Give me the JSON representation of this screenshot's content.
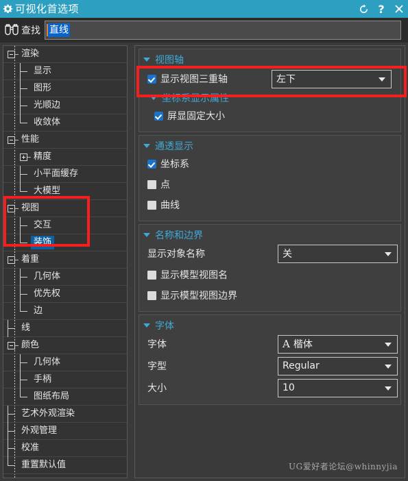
{
  "window": {
    "title": "可视化首选项",
    "icon": "gear-icon",
    "buttons": [
      {
        "name": "reset-button",
        "icon": "reset-icon",
        "label": "↺"
      },
      {
        "name": "help-button",
        "icon": "help-icon",
        "label": "?"
      },
      {
        "name": "close-button",
        "icon": "close-icon",
        "label": "×"
      }
    ]
  },
  "find": {
    "icon": "binoculars-icon",
    "label": "查找",
    "value": "直线",
    "placeholder": ""
  },
  "tree": {
    "items": [
      {
        "label": "渲染",
        "level": 0,
        "expander": "minus",
        "last": false
      },
      {
        "label": "显示",
        "level": 1,
        "expander": "none",
        "last": false
      },
      {
        "label": "图形",
        "level": 1,
        "expander": "none",
        "last": false
      },
      {
        "label": "光顺边",
        "level": 1,
        "expander": "none",
        "last": false
      },
      {
        "label": "收敛体",
        "level": 1,
        "expander": "none",
        "last": true
      },
      {
        "label": "性能",
        "level": 0,
        "expander": "minus",
        "last": false
      },
      {
        "label": "精度",
        "level": 1,
        "expander": "plus",
        "last": false
      },
      {
        "label": "小平面缓存",
        "level": 1,
        "expander": "none",
        "last": false
      },
      {
        "label": "大模型",
        "level": 1,
        "expander": "none",
        "last": true
      },
      {
        "label": "视图",
        "level": 0,
        "expander": "minus",
        "last": false
      },
      {
        "label": "交互",
        "level": 1,
        "expander": "none",
        "last": false
      },
      {
        "label": "装饰",
        "level": 1,
        "expander": "none",
        "last": true,
        "selected": true
      },
      {
        "label": "着重",
        "level": 0,
        "expander": "minus",
        "last": false
      },
      {
        "label": "几何体",
        "level": 1,
        "expander": "none",
        "last": false
      },
      {
        "label": "优先权",
        "level": 1,
        "expander": "none",
        "last": false
      },
      {
        "label": "边",
        "level": 1,
        "expander": "none",
        "last": true
      },
      {
        "label": "线",
        "level": 0,
        "expander": "none",
        "last": false
      },
      {
        "label": "颜色",
        "level": 0,
        "expander": "minus",
        "last": false
      },
      {
        "label": "几何体",
        "level": 1,
        "expander": "none",
        "last": false
      },
      {
        "label": "手柄",
        "level": 1,
        "expander": "none",
        "last": false
      },
      {
        "label": "图纸布局",
        "level": 1,
        "expander": "none",
        "last": true
      },
      {
        "label": "艺术外观渲染",
        "level": 0,
        "expander": "none",
        "last": false
      },
      {
        "label": "外观管理",
        "level": 0,
        "expander": "none",
        "last": false
      },
      {
        "label": "校准",
        "level": 0,
        "expander": "none",
        "last": false
      },
      {
        "label": "重置默认值",
        "level": 0,
        "expander": "none",
        "last": true
      }
    ],
    "highlight_color": "#f51f1f"
  },
  "panel": {
    "groups": [
      {
        "title": "视图轴",
        "name": "view-axis-group",
        "rows": [
          {
            "type": "checkbox-dropdown",
            "name": "show-view-triad",
            "label": "显示视图三重轴",
            "checked": true,
            "value": "左下",
            "highlighted": true
          },
          {
            "type": "subheader",
            "name": "csys-display-properties",
            "label": "坐标系显示属性"
          },
          {
            "type": "checkbox",
            "name": "screen-fixed-size",
            "label": "屏显固定大小",
            "checked": true,
            "indent": true
          }
        ]
      },
      {
        "title": "通透显示",
        "name": "translucent-display-group",
        "rows": [
          {
            "type": "checkbox",
            "name": "csys-checkbox",
            "label": "坐标系",
            "checked": true
          },
          {
            "type": "checkbox",
            "name": "point-checkbox",
            "label": "点",
            "checked": false
          },
          {
            "type": "checkbox",
            "name": "curve-checkbox",
            "label": "曲线",
            "checked": false
          }
        ]
      },
      {
        "title": "名称和边界",
        "name": "names-and-borders-group",
        "rows": [
          {
            "type": "field",
            "name": "display-object-name",
            "label": "显示对象名称",
            "value": "关"
          },
          {
            "type": "checkbox",
            "name": "show-model-view-name",
            "label": "显示模型视图名",
            "checked": false
          },
          {
            "type": "checkbox",
            "name": "show-model-view-border",
            "label": "显示模型视图边界",
            "checked": false
          }
        ]
      },
      {
        "title": "字体",
        "name": "font-group",
        "rows": [
          {
            "type": "field",
            "name": "font-family-field",
            "label": "字体",
            "value": "楷体",
            "glyph": "A"
          },
          {
            "type": "field",
            "name": "font-style-field",
            "label": "字型",
            "value": "Regular"
          },
          {
            "type": "field",
            "name": "font-size-field",
            "label": "大小",
            "value": "10"
          }
        ]
      }
    ]
  },
  "watermark": "UG爱好者论坛@whinnyjia",
  "colors": {
    "titlebar": "#2d9fc0",
    "accent": "#3fa9d8",
    "selection": "#1060a0",
    "highlight": "#f51f1f",
    "checkbox_on": "#1a73c8"
  }
}
